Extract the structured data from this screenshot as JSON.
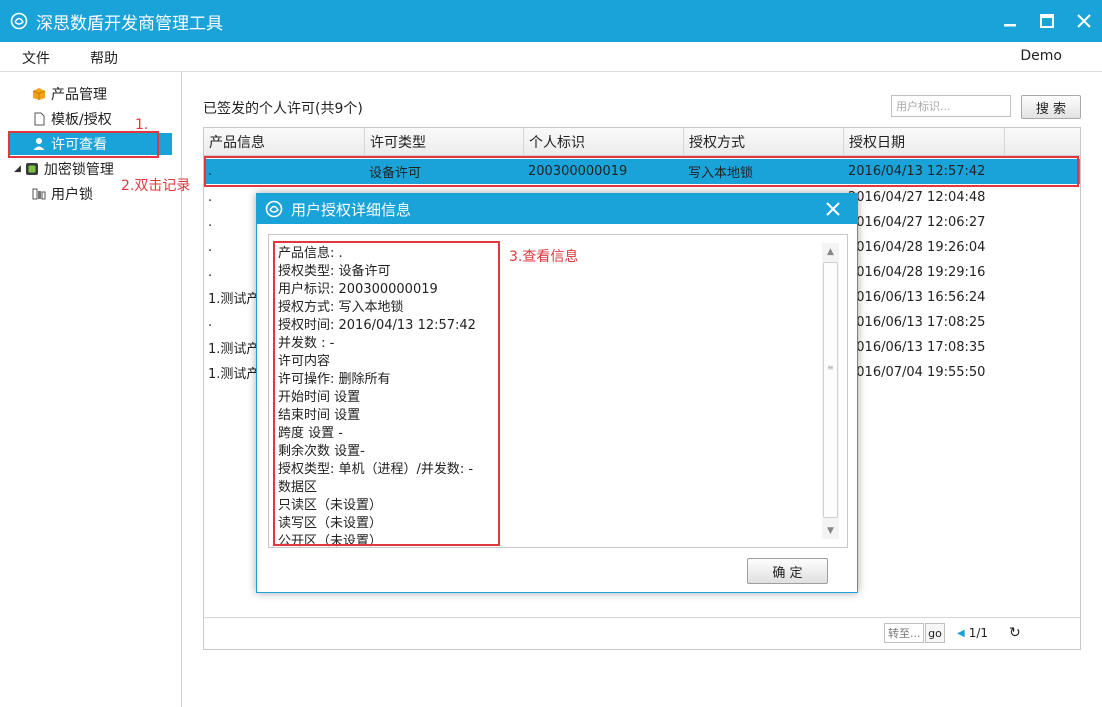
{
  "window": {
    "title": "深思数盾开发商管理工具"
  },
  "menu": {
    "file": "文件",
    "help": "帮助",
    "user": "Demo"
  },
  "sidebar": {
    "items": [
      {
        "label": "产品管理"
      },
      {
        "label": "模板/授权"
      },
      {
        "label": "许可查看"
      },
      {
        "label": "加密锁管理"
      },
      {
        "label": "用户锁"
      }
    ]
  },
  "main": {
    "title": "已签发的个人许可(共9个)",
    "search_placeholder": "用户标识...",
    "search_button": "搜 索",
    "columns": [
      "产品信息",
      "许可类型",
      "个人标识",
      "授权方式",
      "授权日期"
    ],
    "rows": [
      {
        "product": ".",
        "type": "设备许可",
        "id": "200300000019",
        "method": "写入本地锁",
        "date": "2016/04/13 12:57:42"
      },
      {
        "product": ".",
        "type": "",
        "id": "",
        "method": "",
        "date": "2016/04/27 12:04:48"
      },
      {
        "product": ".",
        "type": "",
        "id": "",
        "method": "",
        "date": "2016/04/27 12:06:27"
      },
      {
        "product": ".",
        "type": "",
        "id": "",
        "method": "",
        "date": "2016/04/28 19:26:04"
      },
      {
        "product": ".",
        "type": "",
        "id": "",
        "method": "",
        "date": "2016/04/28 19:29:16"
      },
      {
        "product": "1.测试产",
        "type": "",
        "id": "",
        "method": "",
        "date": "2016/06/13 16:56:24"
      },
      {
        "product": ".",
        "type": "",
        "id": "",
        "method": "",
        "date": "2016/06/13 17:08:25"
      },
      {
        "product": "1.测试产",
        "type": "",
        "id": "",
        "method": "",
        "date": "2016/06/13 17:08:35"
      },
      {
        "product": "1.测试产",
        "type": "",
        "id": "",
        "method": "",
        "date": "2016/07/04 19:55:50"
      }
    ],
    "pager": {
      "goto_placeholder": "转至...",
      "go": "go",
      "page": "1/1"
    }
  },
  "dialog": {
    "title": "用户授权详细信息",
    "lines": [
      "产品信息:  .",
      "授权类型:  设备许可",
      "用户标识:  200300000019",
      "授权方式:  写入本地锁",
      "授权时间:  2016/04/13 12:57:42",
      "并发数   : -",
      "许可内容",
      "许可操作: 删除所有",
      "开始时间 设置",
      "结束时间 设置",
      "跨度        设置 -",
      "剩余次数 设置-",
      "授权类型: 单机（进程）/并发数: -",
      "数据区",
      "只读区（未设置）",
      "读写区（未设置）",
      "公开区（未设置）"
    ],
    "ok_button": "确 定"
  },
  "annotations": {
    "step1": "1.",
    "step2": "2.双击记录",
    "step3": "3.查看信息"
  },
  "colors": {
    "accent": "#1aa3d9",
    "annotation": "#e0383e"
  }
}
